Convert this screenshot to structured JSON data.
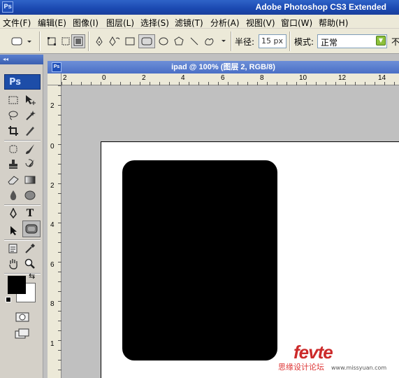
{
  "app": {
    "title": "Adobe Photoshop CS3 Extended",
    "logo_text": "Ps"
  },
  "menu": [
    {
      "label": "文件(F)"
    },
    {
      "label": "编辑(E)"
    },
    {
      "label": "图像(I)"
    },
    {
      "label": "图层(L)"
    },
    {
      "label": "选择(S)"
    },
    {
      "label": "滤镜(T)"
    },
    {
      "label": "分析(A)"
    },
    {
      "label": "视图(V)"
    },
    {
      "label": "窗口(W)"
    },
    {
      "label": "帮助(H)"
    }
  ],
  "options": {
    "radius_label": "半径:",
    "radius_value": "15 px",
    "mode_label": "模式:",
    "mode_value": "正常",
    "opacity_label": "不"
  },
  "toolbox": {
    "grip": "◂◂",
    "logo": "Ps"
  },
  "document": {
    "title": "ipad @ 100% (图层 2, RGB/8)",
    "icon_text": "Ps",
    "hruler": [
      "2",
      "0",
      "2",
      "4",
      "6",
      "8",
      "10",
      "12",
      "14"
    ],
    "vruler": [
      "2",
      "0",
      "2",
      "4",
      "6",
      "8",
      "1"
    ]
  },
  "colors": {
    "foreground": "#000000",
    "background": "#ffffff",
    "shape_fill": "#000000",
    "accent": "#2f63c8"
  },
  "watermark": {
    "logo": "fevte",
    "text": "思缘设计论坛",
    "url": "www.missyuan.com"
  }
}
